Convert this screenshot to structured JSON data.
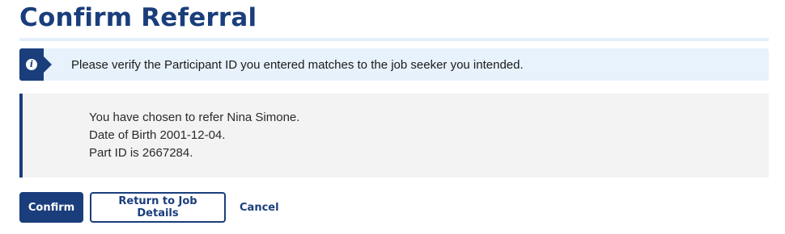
{
  "page": {
    "title": "Confirm Referral"
  },
  "alert": {
    "icon": "info-icon",
    "message": "Please verify the Participant ID you entered matches to the job seeker you intended."
  },
  "summary": {
    "line1": "You have chosen to refer Nina Simone.",
    "line2": "Date of Birth 2001-12-04.",
    "line3": "Part ID is 2667284."
  },
  "actions": {
    "confirm_label": "Confirm",
    "return_label": "Return to Job Details",
    "cancel_label": "Cancel"
  },
  "colors": {
    "primary": "#1a3e7c",
    "alert_background": "#e8f2fc",
    "summary_background": "#f3f3f3"
  }
}
